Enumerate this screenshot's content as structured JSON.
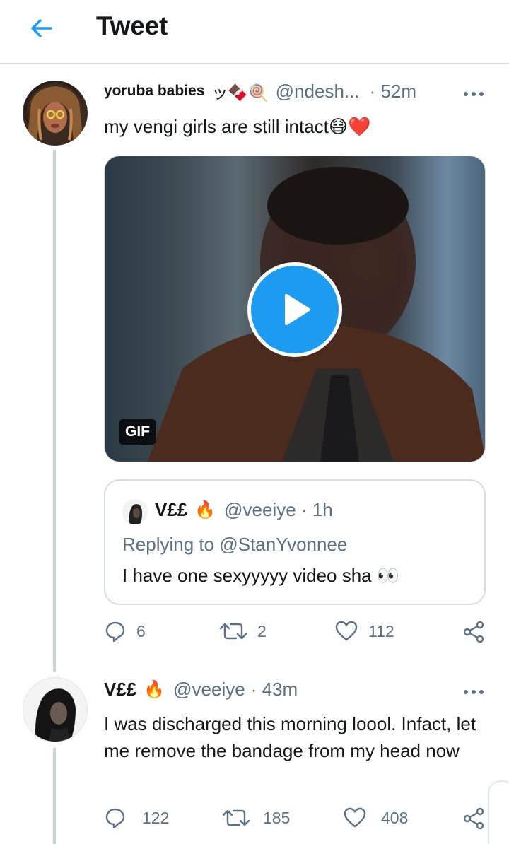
{
  "header": {
    "title": "Tweet"
  },
  "tweet1": {
    "display_name": "yoruba babies",
    "name_emoji": "ッ🍫🍭",
    "handle": "@ndesh...",
    "time": "· 52m",
    "text": "my vengi girls are still intact😷❤️",
    "gif_label": "GIF",
    "quoted": {
      "display_name": "V££",
      "name_emoji": "🔥",
      "handle": "@veeiye · 1h",
      "replying_to": "Replying to @StanYvonnee",
      "text": "I have one sexyyyyy video sha 👀"
    },
    "stats": {
      "replies": "6",
      "retweets": "2",
      "likes": "112"
    }
  },
  "tweet2": {
    "display_name": "V££",
    "name_emoji": "🔥",
    "handle": "@veeiye",
    "time": "· 43m",
    "text": "I was discharged this morning loool. Infact, let me remove the bandage from my head now",
    "stats": {
      "replies": "122",
      "retweets": "185",
      "likes": "408"
    }
  },
  "icons": {
    "back": "arrow-left-icon",
    "more": "more-horizontal-icon",
    "reply": "reply-icon",
    "retweet": "retweet-icon",
    "like": "heart-icon",
    "share": "share-icon",
    "play": "play-icon"
  },
  "colors": {
    "accent": "#1d9bf0",
    "secondary_text": "#5b7083",
    "primary_text": "#14171a",
    "border": "#d7dce0"
  }
}
